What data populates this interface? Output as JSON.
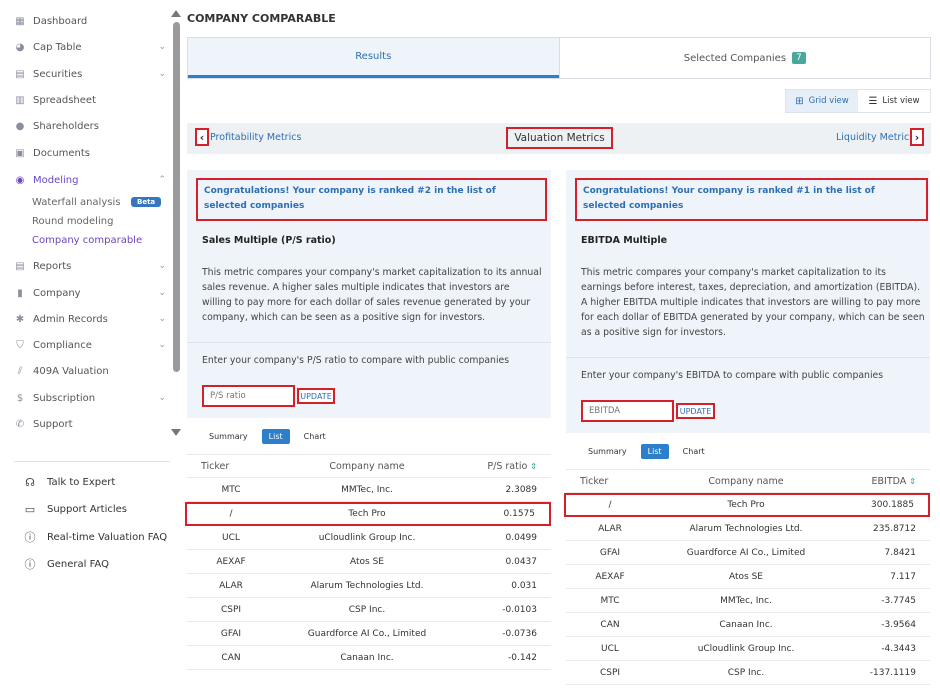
{
  "sidebar": {
    "items": [
      {
        "label": "Dashboard",
        "icon": "dashboard-icon",
        "chevron": ""
      },
      {
        "label": "Cap Table",
        "icon": "pie-chart-icon",
        "chevron": "⌄"
      },
      {
        "label": "Securities",
        "icon": "document-icon",
        "chevron": "⌄"
      },
      {
        "label": "Spreadsheet",
        "icon": "table-icon",
        "chevron": ""
      },
      {
        "label": "Shareholders",
        "icon": "user-icon",
        "chevron": ""
      },
      {
        "label": "Documents",
        "icon": "folder-icon",
        "chevron": ""
      },
      {
        "label": "Modeling",
        "icon": "bulb-icon",
        "chevron": "⌃"
      },
      {
        "label": "Reports",
        "icon": "report-icon",
        "chevron": "⌄"
      },
      {
        "label": "Company",
        "icon": "building-icon",
        "chevron": "⌄"
      },
      {
        "label": "Admin Records",
        "icon": "gear-icon",
        "chevron": "⌄"
      },
      {
        "label": "Compliance",
        "icon": "shield-icon",
        "chevron": "⌄"
      },
      {
        "label": "409A Valuation",
        "icon": "chart-icon",
        "chevron": ""
      },
      {
        "label": "Subscription",
        "icon": "dollar-icon",
        "chevron": "⌄"
      },
      {
        "label": "Support",
        "icon": "support-icon",
        "chevron": ""
      }
    ],
    "subitems": [
      {
        "label": "Waterfall analysis"
      },
      {
        "label": "Round modeling"
      },
      {
        "label": "Company comparable"
      }
    ],
    "beta_label": "Beta",
    "help": [
      {
        "label": "Talk to Expert",
        "icon": "headset-icon"
      },
      {
        "label": "Support Articles",
        "icon": "book-icon"
      },
      {
        "label": "Real-time Valuation FAQ",
        "icon": "question-icon"
      },
      {
        "label": "General FAQ",
        "icon": "question-icon"
      }
    ]
  },
  "page_title": "COMPANY COMPARABLE",
  "tabs": {
    "results": "Results",
    "selected": "Selected Companies",
    "selected_count": "7"
  },
  "view_toggle": {
    "grid": "Grid view",
    "list": "List view"
  },
  "metrics": {
    "prev": "Profitability Metrics",
    "current": "Valuation Metrics",
    "next": "Liquidity Metrics"
  },
  "panels": [
    {
      "congrats": "Congratulations! Your company is ranked #2 in the list of selected companies",
      "metric_name": "Sales Multiple (P/S ratio)",
      "description": "This metric compares your company's market capitalization to its annual sales revenue. A higher sales multiple indicates that investors are willing to pay more for each dollar of sales revenue generated by your company, which can be seen as a positive sign for investors.",
      "enter_label": "Enter your company's P/S ratio to compare with public companies",
      "input_placeholder": "P/S ratio",
      "update": "UPDATE",
      "subtabs": [
        "Summary",
        "List",
        "Chart"
      ],
      "columns": [
        "Ticker",
        "Company name",
        "P/S ratio"
      ],
      "rows": [
        {
          "ticker": "MTC",
          "name": "MMTec, Inc.",
          "value": "2.3089",
          "highlight": false
        },
        {
          "ticker": "/",
          "name": "Tech Pro",
          "value": "0.1575",
          "highlight": true
        },
        {
          "ticker": "UCL",
          "name": "uCloudlink Group Inc.",
          "value": "0.0499",
          "highlight": false
        },
        {
          "ticker": "AEXAF",
          "name": "Atos SE",
          "value": "0.0437",
          "highlight": false
        },
        {
          "ticker": "ALAR",
          "name": "Alarum Technologies Ltd.",
          "value": "0.031",
          "highlight": false
        },
        {
          "ticker": "CSPI",
          "name": "CSP Inc.",
          "value": "-0.0103",
          "highlight": false
        },
        {
          "ticker": "GFAI",
          "name": "Guardforce AI Co., Limited",
          "value": "-0.0736",
          "highlight": false
        },
        {
          "ticker": "CAN",
          "name": "Canaan Inc.",
          "value": "-0.142",
          "highlight": false
        }
      ]
    },
    {
      "congrats": "Congratulations! Your company is ranked #1 in the list of selected companies",
      "metric_name": "EBITDA Multiple",
      "description": "This metric compares your company's market capitalization to its earnings before interest, taxes, depreciation, and amortization (EBITDA). A higher EBITDA multiple indicates that investors are willing to pay more for each dollar of EBITDA generated by your company, which can be seen as a positive sign for investors.",
      "enter_label": "Enter your company's EBITDA to compare with public companies",
      "input_placeholder": "EBITDA",
      "update": "UPDATE",
      "subtabs": [
        "Summary",
        "List",
        "Chart"
      ],
      "columns": [
        "Ticker",
        "Company name",
        "EBITDA"
      ],
      "rows": [
        {
          "ticker": "/",
          "name": "Tech Pro",
          "value": "300.1885",
          "highlight": true
        },
        {
          "ticker": "ALAR",
          "name": "Alarum Technologies Ltd.",
          "value": "235.8712",
          "highlight": false
        },
        {
          "ticker": "GFAI",
          "name": "Guardforce AI Co., Limited",
          "value": "7.8421",
          "highlight": false
        },
        {
          "ticker": "AEXAF",
          "name": "Atos SE",
          "value": "7.117",
          "highlight": false
        },
        {
          "ticker": "MTC",
          "name": "MMTec, Inc.",
          "value": "-3.7745",
          "highlight": false
        },
        {
          "ticker": "CAN",
          "name": "Canaan Inc.",
          "value": "-3.9564",
          "highlight": false
        },
        {
          "ticker": "UCL",
          "name": "uCloudlink Group Inc.",
          "value": "-4.3443",
          "highlight": false
        },
        {
          "ticker": "CSPI",
          "name": "CSP Inc.",
          "value": "-137.1119",
          "highlight": false
        }
      ]
    }
  ]
}
